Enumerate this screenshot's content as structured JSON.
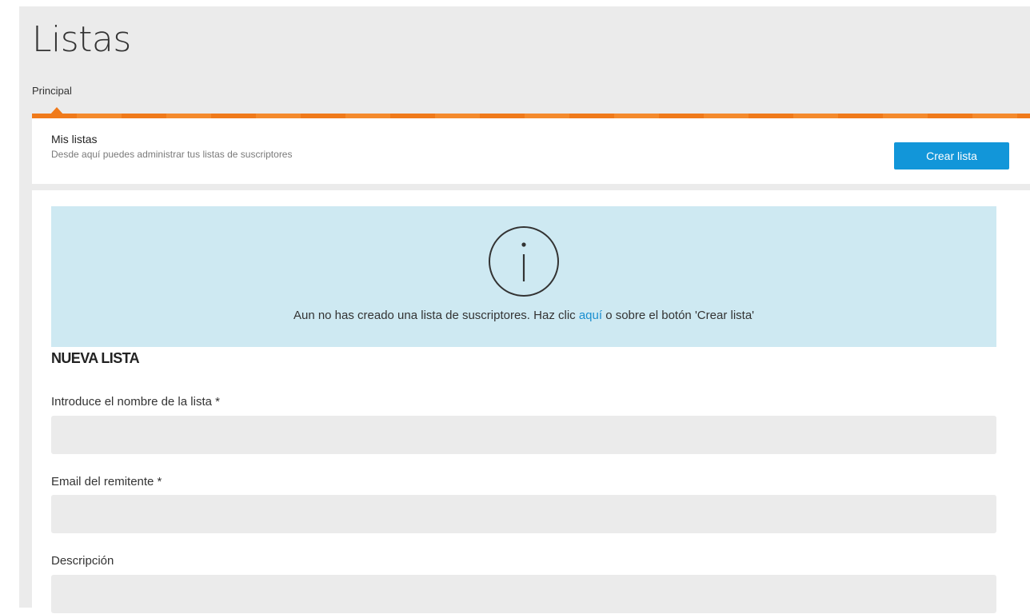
{
  "page": {
    "title": "Listas"
  },
  "tabs": [
    {
      "label": "Principal",
      "active": true
    }
  ],
  "header": {
    "title": "Mis listas",
    "subtitle": "Desde aquí puedes administrar tus listas de suscriptores",
    "create_button_label": "Crear lista"
  },
  "notice": {
    "icon": "info-circle-icon",
    "text_before": "Aun no has creado una lista de suscriptores. Haz clic ",
    "link_text": "aquí",
    "text_after": " o sobre el botón 'Crear lista'"
  },
  "form": {
    "section_title": "NUEVA LISTA",
    "fields": [
      {
        "label": "Introduce el nombre de la lista *",
        "value": "",
        "placeholder": ""
      },
      {
        "label": "Email del remitente *",
        "value": "",
        "placeholder": ""
      },
      {
        "label": "Descripción",
        "value": "",
        "placeholder": ""
      }
    ]
  },
  "colors": {
    "accent_orange": "#f07a1a",
    "primary_blue": "#1296d9",
    "info_background": "#cee9f2",
    "link_blue": "#1a8fd0"
  }
}
